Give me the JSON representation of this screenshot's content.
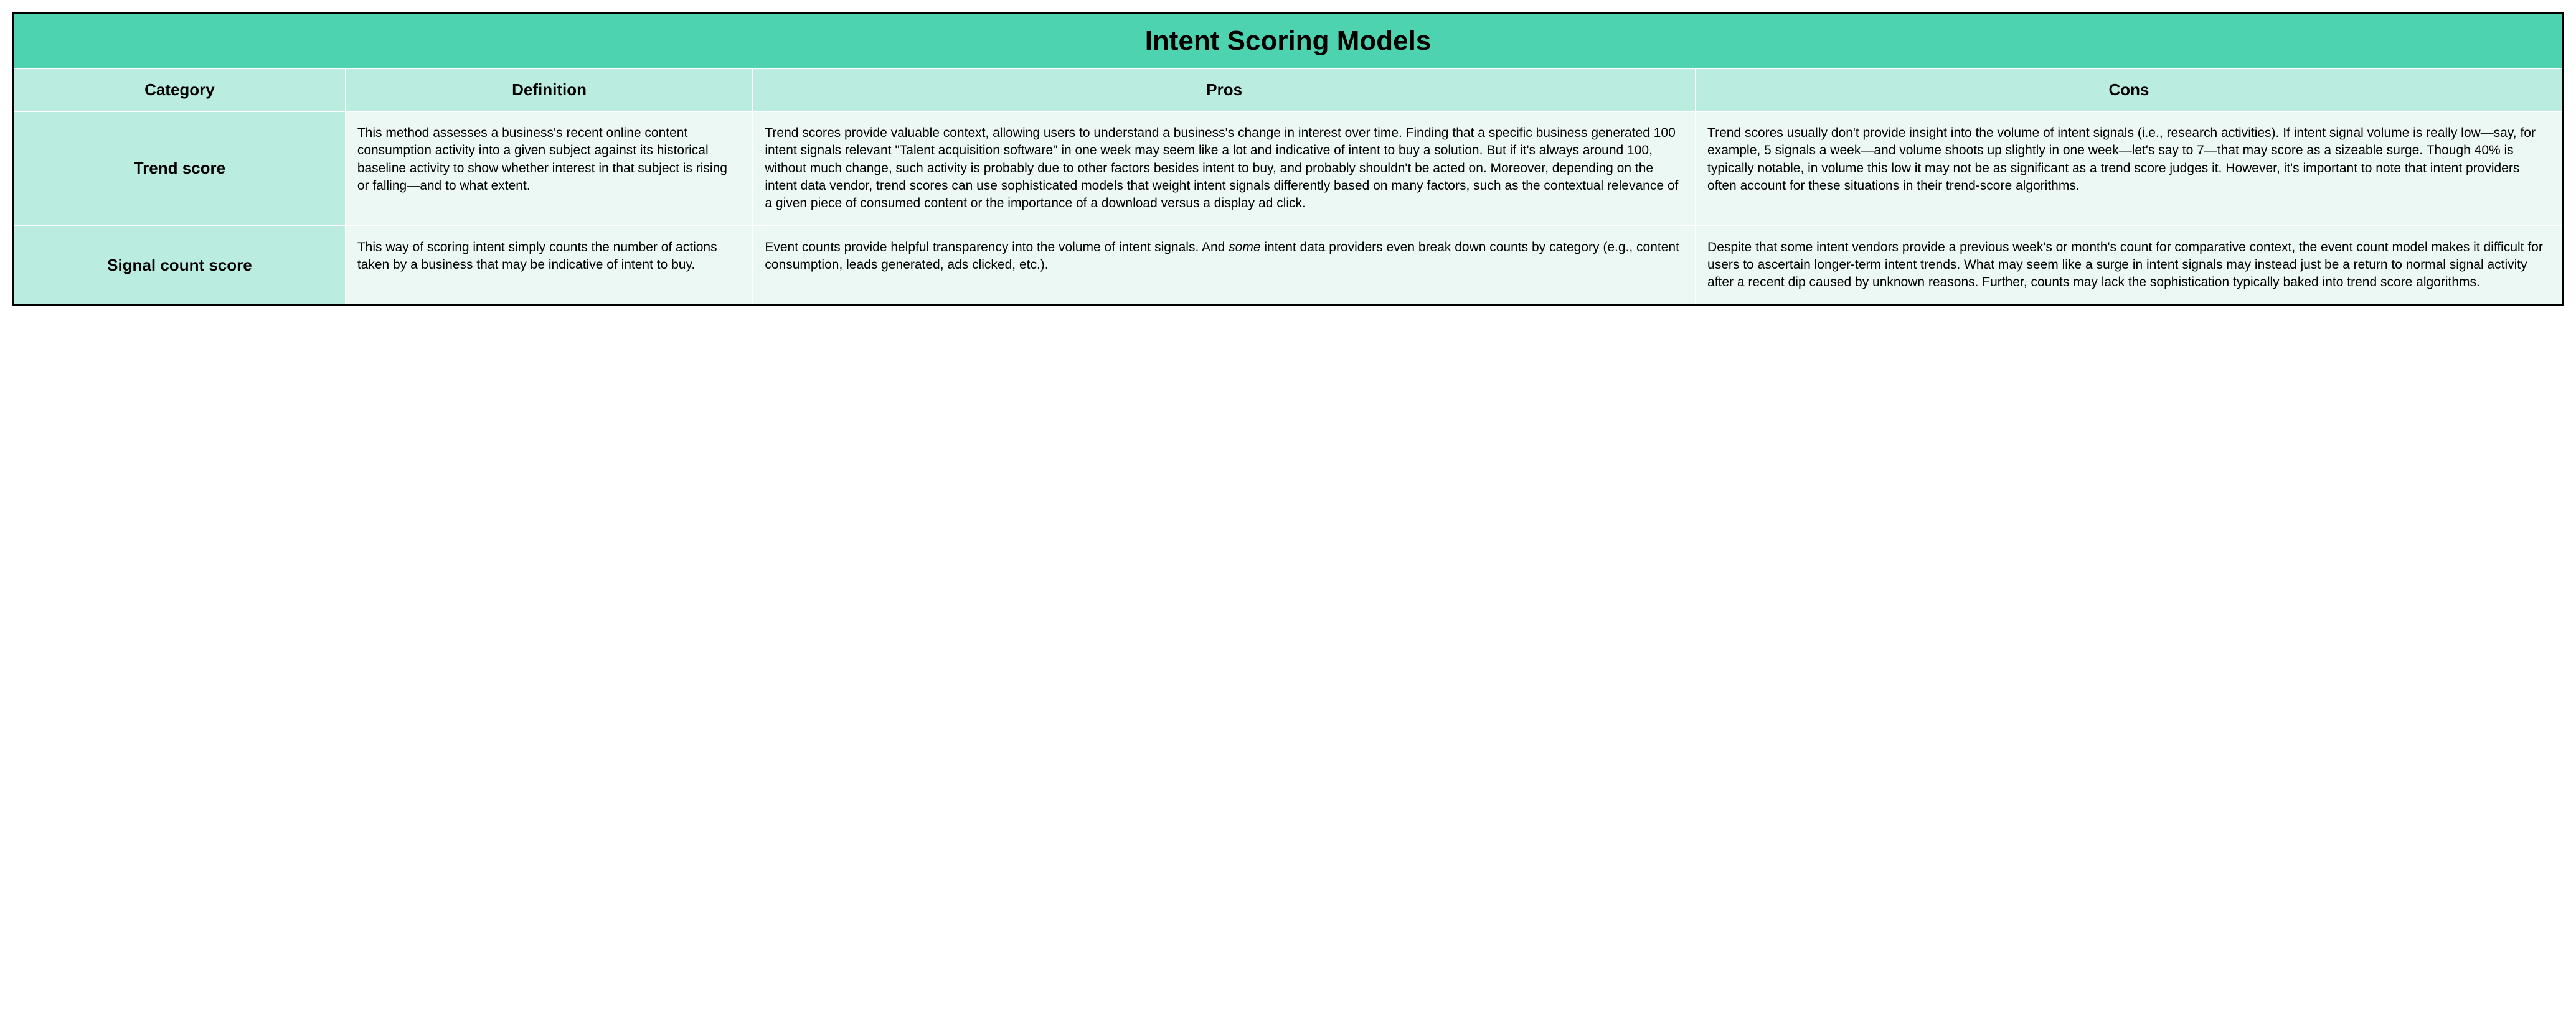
{
  "title": "Intent Scoring Models",
  "columns": [
    "Category",
    "Definition",
    "Pros",
    "Cons"
  ],
  "rows": [
    {
      "category": "Trend score",
      "definition": "This method assesses a business's recent online content consumption activity into a given subject against its historical baseline activity to show whether interest in that subject is rising or falling—and to what extent.",
      "pros": "Trend scores provide valuable context, allowing users to understand a business's change in interest over time. Finding that a specific business generated 100 intent signals relevant \"Talent acquisition software\" in one week may seem like a lot and indicative of intent to buy a solution. But if it's always around 100, without much change, such activity is probably due to other factors besides intent to buy, and probably shouldn't be acted on. Moreover, depending on the intent data vendor, trend scores can use sophisticated models that weight intent signals differently based on many factors, such as the contextual relevance of a given piece of consumed content or the importance of a download versus a display ad click.",
      "cons": "Trend scores usually don't provide insight into the volume of intent signals (i.e., research activities). If intent signal volume is really low—say, for example, 5 signals a week—and volume shoots up slightly in one week—let's say to 7—that may score as a sizeable surge. Though 40% is typically notable, in volume this low it may not be as significant as a trend score judges it. However, it's important to note that intent providers often account for these situations in their trend-score algorithms."
    },
    {
      "category": "Signal count score",
      "definition": "This way of scoring intent simply counts the number of actions taken by a business that may be indicative of intent to buy.",
      "pros_pre": "Event counts provide helpful transparency into the volume of intent signals. And ",
      "pros_em": "some",
      "pros_post": " intent data providers even break down counts by category (e.g., content consumption, leads generated, ads clicked, etc.).",
      "cons": "Despite that some intent vendors provide a previous week's or month's count for comparative context, the event count model makes it difficult for users to ascertain longer-term intent trends. What may seem like a surge in intent signals may instead just be a return to normal signal activity after a recent dip caused by unknown reasons. Further, counts may lack the sophistication typically baked into trend score algorithms."
    }
  ]
}
